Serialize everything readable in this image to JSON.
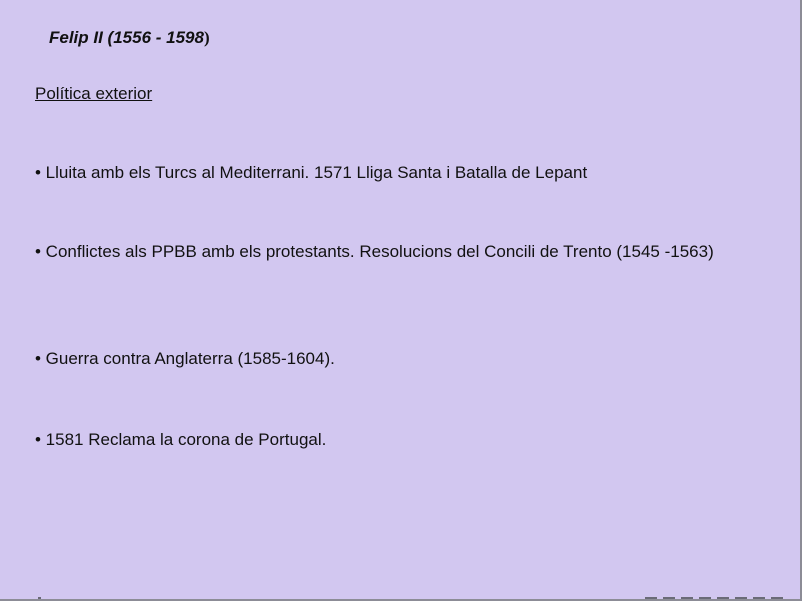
{
  "slide": {
    "title_main": "Felip II (1556 - 1598",
    "title_close": ")",
    "subtitle": "Política exterior",
    "bullets": [
      "• Lluita amb els Turcs al Mediterrani. 1571 Lliga Santa i Batalla de Lepant",
      "• Conflictes als PPBB amb els protestants. Resolucions del Concili de Trento (1545 -1563)",
      "• Guerra contra Anglaterra (1585-1604).",
      "• 1581 Reclama la corona de Portugal."
    ]
  }
}
